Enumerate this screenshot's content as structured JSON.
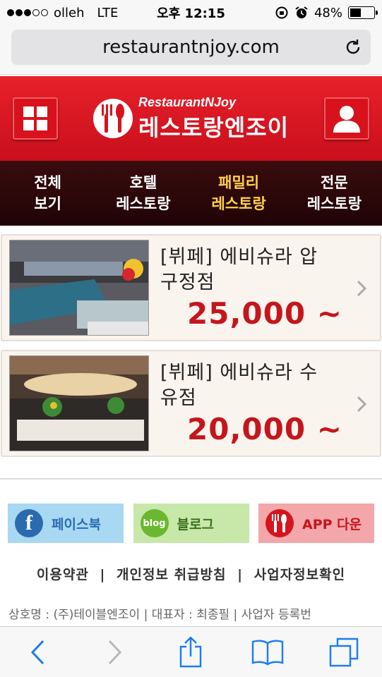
{
  "status_bar": {
    "carrier": "olleh",
    "network": "LTE",
    "time": "오후 12:15",
    "battery": "48%",
    "battery_level": 0.48
  },
  "browser": {
    "url": "restaurantnjoy.com",
    "icons": [
      "reload-icon",
      "back-icon",
      "forward-icon",
      "share-icon",
      "bookmarks-icon",
      "tabs-icon"
    ]
  },
  "header": {
    "logo_en": "RestaurantNJoy",
    "logo_ko": "레스토랑엔조이",
    "accent": "#d8121c"
  },
  "nav": {
    "items": [
      {
        "line1": "전체",
        "line2": "보기"
      },
      {
        "line1": "호텔",
        "line2": "레스토랑"
      },
      {
        "line1": "패밀리",
        "line2": "레스토랑"
      },
      {
        "line1": "전문",
        "line2": "레스토랑"
      }
    ],
    "active_index": 2,
    "active_color": "#ffd24a"
  },
  "restaurants": [
    {
      "title_line1": "[뷔페] 에비슈라 압",
      "title_line2": "구정점",
      "price": "25,000 ~"
    },
    {
      "title_line1": "[뷔페] 에비슈라 수",
      "title_line2": "유점",
      "price": "20,000 ~"
    }
  ],
  "social": {
    "facebook": "페이스북",
    "facebook_icon_letter": "f",
    "blog": "블로그",
    "blog_icon_text": "blog",
    "app": "APP 다운"
  },
  "footer": {
    "terms": "이용약관",
    "privacy": "개인정보 취급방침",
    "business": "사업자정보확인",
    "separator": "|",
    "company_line": "상호명 : (주)테이블엔조이 | 대표자 : 최종필 | 사업자 등록번"
  }
}
